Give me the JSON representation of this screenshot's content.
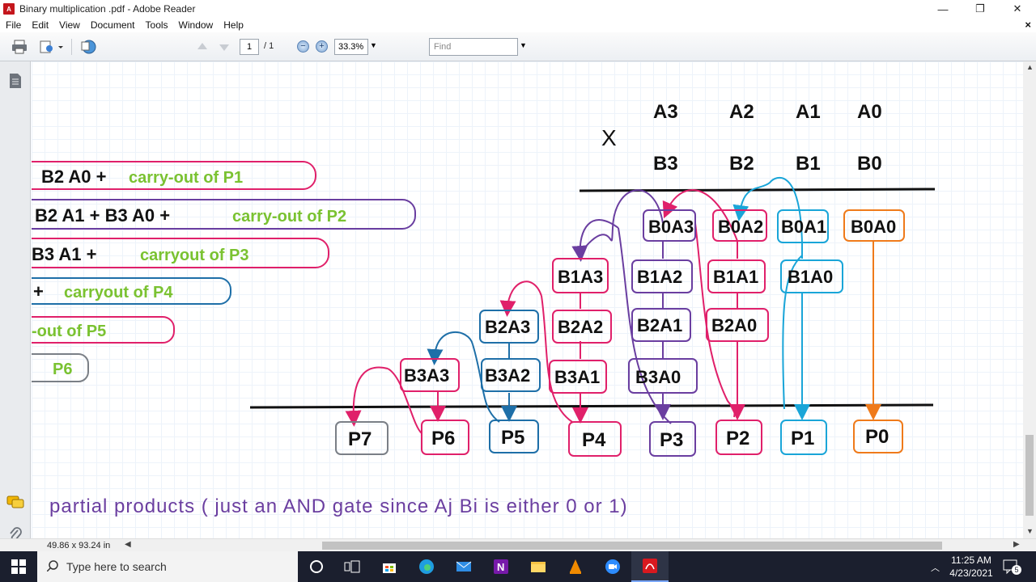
{
  "window": {
    "title": "Binary multiplication .pdf - Adobe Reader",
    "icon": "pdf-icon"
  },
  "menu": [
    "File",
    "Edit",
    "View",
    "Document",
    "Tools",
    "Window",
    "Help"
  ],
  "toolbar": {
    "page_current": "1",
    "page_total": "/ 1",
    "zoom": "33.3%",
    "find_placeholder": "Find"
  },
  "status": {
    "page_size": "49.86 x 93.24 in"
  },
  "taskbar": {
    "search_placeholder": "Type here to search",
    "time": "11:25 AM",
    "date": "4/23/2021",
    "notifications": "5"
  },
  "document": {
    "multiply_sign": "X",
    "top_row": [
      "A3",
      "A2",
      "A1",
      "A0"
    ],
    "second_row": [
      "B3",
      "B2",
      "B1",
      "B0"
    ],
    "left_equations": [
      {
        "main": "B2 A0 +",
        "green": "carry-out of P1"
      },
      {
        "main": "B2 A1 + B3 A0 +",
        "green": "carry-out of P2"
      },
      {
        "main": "B3 A1 +",
        "green": "carryout of P3"
      },
      {
        "main": "+",
        "green": "carryout of P4"
      },
      {
        "main": "",
        "green": "-out of P5"
      },
      {
        "main": "",
        "green": "P6"
      }
    ],
    "partial_products": [
      "B0A3",
      "B0A2",
      "B0A1",
      "B0A0",
      "B1A3",
      "B1A2",
      "B1A1",
      "B1A0",
      "B2A3",
      "B2A2",
      "B2A1",
      "B2A0",
      "B3A3",
      "B3A2",
      "B3A1",
      "B3A0"
    ],
    "outputs": [
      "P7",
      "P6",
      "P5",
      "P4",
      "P3",
      "P2",
      "P1",
      "P0"
    ],
    "caption": "partial products ( just an AND gate since Aj Bi is either 0 or 1)"
  },
  "colors": {
    "pink": "#e0206a",
    "blue": "#1e6fa8",
    "purple": "#6a3ea0",
    "cyan": "#19a5d8",
    "orange": "#ef7a1a",
    "gray": "#7a7f86",
    "green": "#7ac231",
    "taskbar": "#1b1f2e"
  }
}
